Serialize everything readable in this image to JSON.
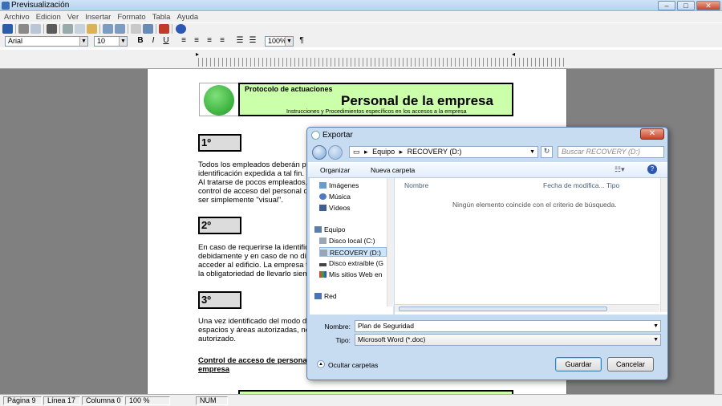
{
  "window": {
    "title": "Previsualización"
  },
  "menu": [
    "Archivo",
    "Edicion",
    "Ver",
    "Insertar",
    "Formato",
    "Tabla",
    "Ayuda"
  ],
  "format": {
    "font": "Arial",
    "size": "10",
    "zoom": "100%",
    "bold": "B",
    "italic": "I",
    "underline": "U",
    "para_mark": "¶"
  },
  "doc": {
    "header_title": "Protocolo de actuaciones",
    "header_main": "Personal de la empresa",
    "header_sub": "Instrucciones y Procedimientos específicos en los accesos a la empresa",
    "steps": [
      "1º",
      "2º",
      "3º"
    ],
    "p1": [
      "Todos los empleados deberán p",
      "identificación expedida a tal fin.",
      "Al tratarse de pocos empleados,",
      "control de acceso del personal que",
      "ser simplemente \"visual\"."
    ],
    "p2": [
      "En caso de requerirse la identific",
      "debidamente y en caso de no dis",
      "acceder al edificio. La empresa to",
      "la obligatoriedad de llevarlo siempre"
    ],
    "p3": [
      "Una vez identificado del modo de",
      "espacios y áreas autorizadas, no",
      "autorizado."
    ],
    "section_title": [
      "Control de acceso de personas",
      "empresa"
    ]
  },
  "status": {
    "page": "Página  9",
    "line": "Línea  17",
    "column": "Columna  0",
    "zoom": "100 %",
    "num": "NUM"
  },
  "dialog": {
    "title": "Exportar",
    "path": [
      "Equipo",
      "RECOVERY (D:)"
    ],
    "search_placeholder": "Buscar RECOVERY (D:)",
    "organize": "Organizar",
    "new_folder": "Nueva carpeta",
    "nav": [
      "Imágenes",
      "Música",
      "Vídeos",
      "Equipo",
      "Disco local (C:)",
      "RECOVERY (D:)",
      "Disco extraíble (G",
      "Mis sitios Web en",
      "Red"
    ],
    "columns": [
      "Nombre",
      "Fecha de modifica...",
      "Tipo"
    ],
    "empty_msg": "Ningún elemento coincide con el criterio de búsqueda.",
    "filename_label": "Nombre:",
    "filename_value": "Plan de Seguridad",
    "type_label": "Tipo:",
    "type_value": "Microsoft Word (*.doc)",
    "hide_folders": "Ocultar carpetas",
    "save": "Guardar",
    "cancel": "Cancelar"
  }
}
